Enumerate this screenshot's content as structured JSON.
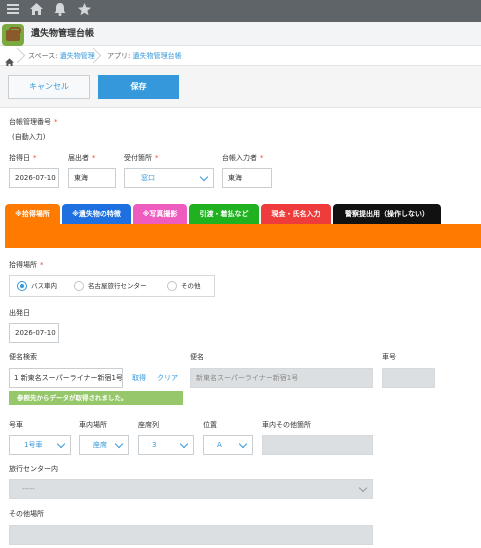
{
  "topbar": {
    "icons": [
      "menu-icon",
      "home-icon",
      "bell-icon",
      "star-icon"
    ]
  },
  "app": {
    "title": "遺失物管理台帳"
  },
  "breadcrumb": {
    "space_prefix": "スペース: ",
    "space_name": "遺失物管理",
    "app_prefix": "アプリ: ",
    "app_name": "遺失物管理台帳"
  },
  "toolbar": {
    "cancel_label": "キャンセル",
    "save_label": "保存"
  },
  "form": {
    "ledger_no_label": "台帳管理番号",
    "ledger_no_value": "(自動入力)",
    "found_date_label": "拾得日",
    "found_date_value": "2026-07-10",
    "reporter_label": "届出者",
    "reporter_value": "東海",
    "reception_label": "受付箇所",
    "reception_value": "窓口",
    "entry_person_label": "台帳入力者",
    "entry_person_value": "東海"
  },
  "tabs": [
    {
      "label": "※拾得場所",
      "color": "#ff7a00"
    },
    {
      "label": "※遺失物の特徴",
      "color": "#1e6fe0"
    },
    {
      "label": "※写真撮影",
      "color": "#ee5cc0"
    },
    {
      "label": "引渡・着払など",
      "color": "#1fb11f"
    },
    {
      "label": "現金・氏名入力",
      "color": "#ee3b3b"
    },
    {
      "label": "警察提出用（操作しない）",
      "color": "#111111"
    }
  ],
  "location": {
    "label": "拾得場所",
    "options": [
      "バス車内",
      "名古屋旅行センター",
      "その他"
    ],
    "selected": "バス車内"
  },
  "departure": {
    "label": "出発日",
    "value": "2026-07-10"
  },
  "bus": {
    "search_label": "便名検索",
    "search_value": "1 新東名スーパーライナー新宿1号",
    "fetch_link": "取得",
    "clear_link": "クリア",
    "name_label": "便名",
    "name_value": "新東名スーパーライナー新宿1号",
    "car_no_label": "車号",
    "notice": "参照先からデータが取得されました。"
  },
  "vehicle": {
    "car_label": "号車",
    "car_value": "1号車",
    "place_label": "車内場所",
    "place_value": "座席",
    "row_label": "座席列",
    "row_value": "3",
    "pos_label": "位置",
    "pos_value": "A",
    "other_place_label": "車内その他箇所"
  },
  "travel_center": {
    "label": "旅行センター内",
    "value": "-----"
  },
  "other_place": {
    "label": "その他場所"
  }
}
